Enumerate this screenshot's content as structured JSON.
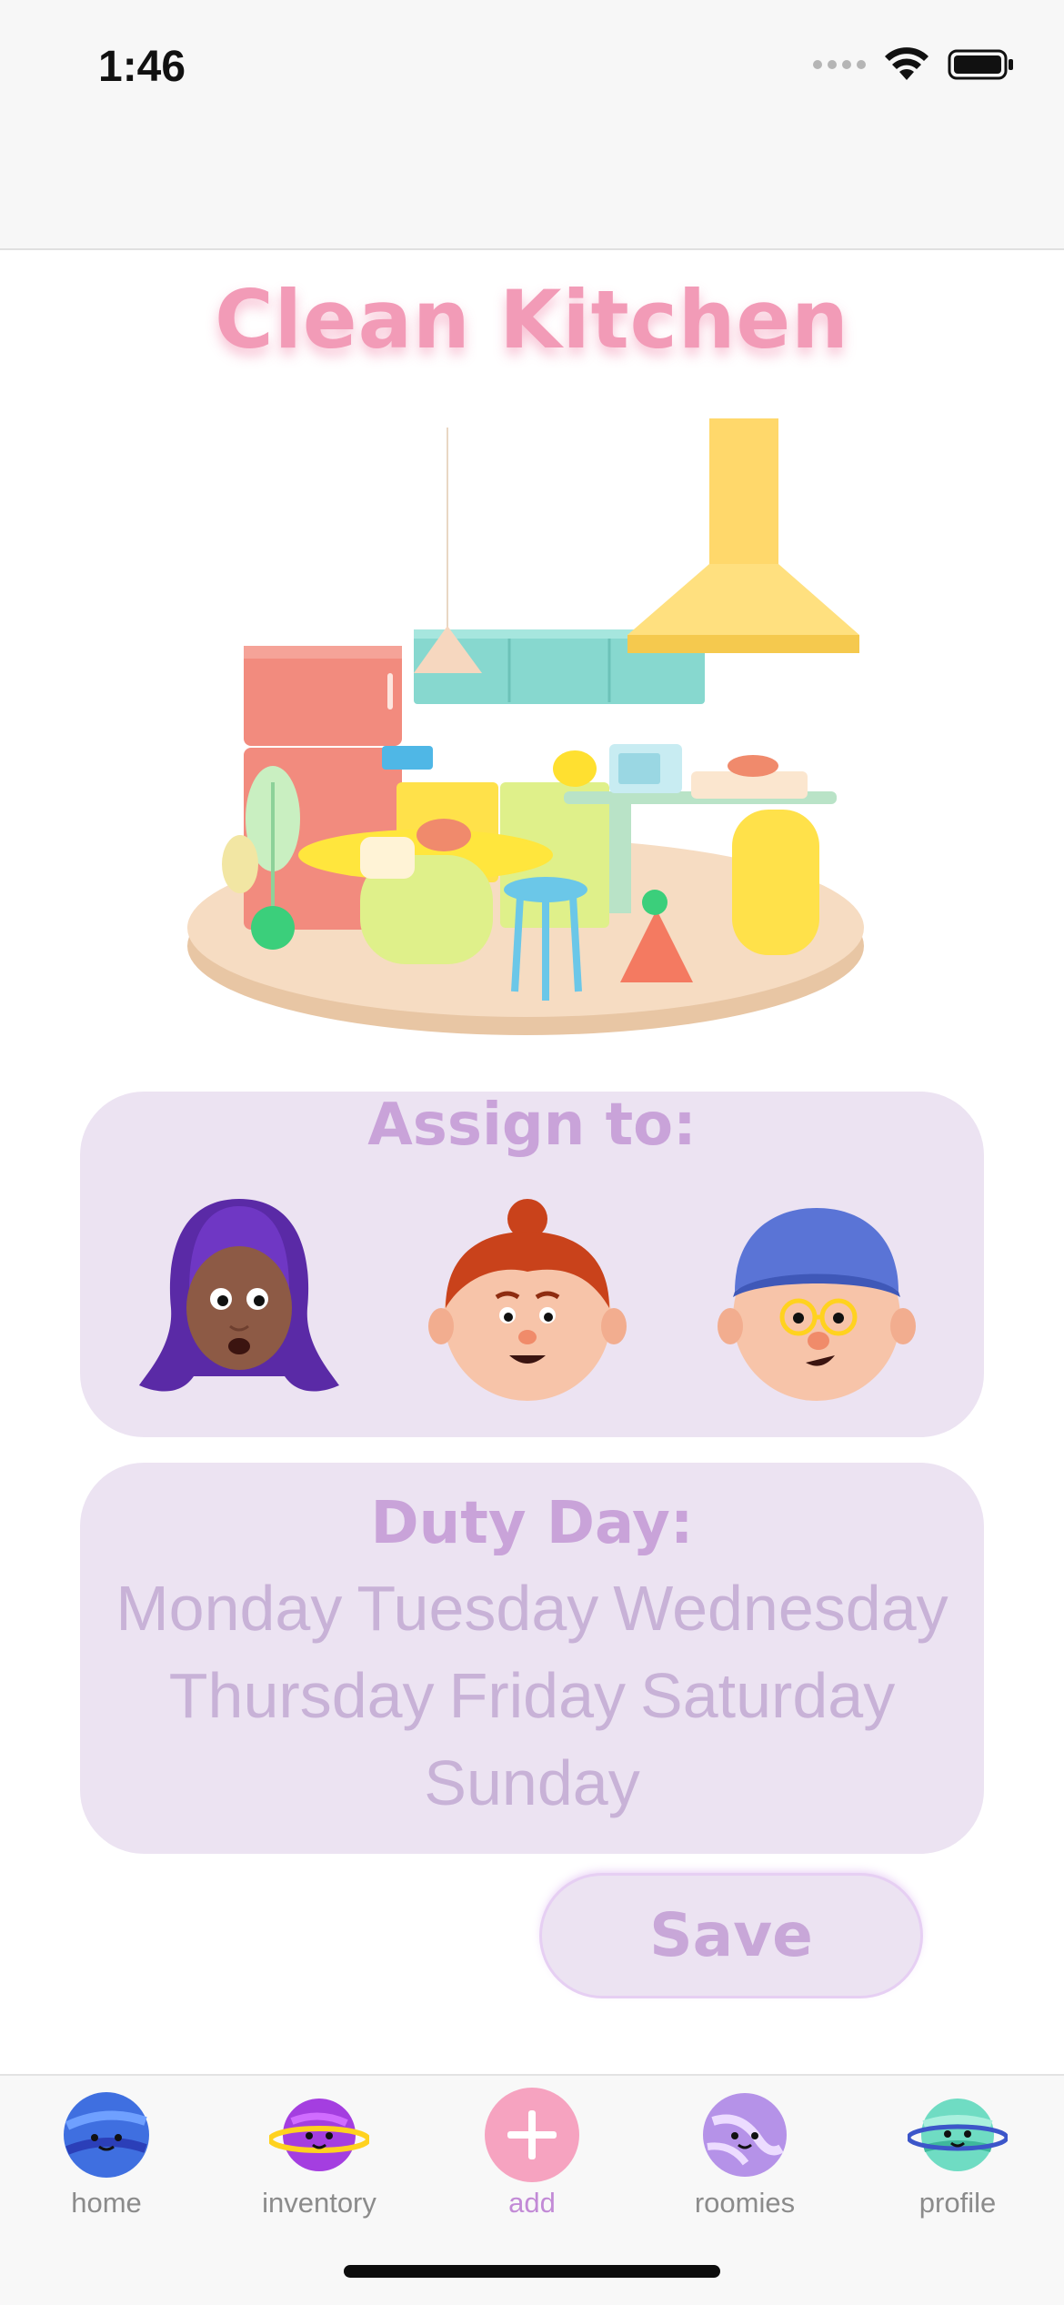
{
  "status_bar": {
    "time": "1:46"
  },
  "page": {
    "title": "Clean Kitchen"
  },
  "assign": {
    "heading": "Assign to:",
    "avatars": [
      {
        "name": "avatar-purple-hair"
      },
      {
        "name": "avatar-red-bun"
      },
      {
        "name": "avatar-blue-cap"
      }
    ]
  },
  "duty": {
    "heading": "Duty Day:",
    "days": [
      "Monday",
      "Tuesday",
      "Wednesday",
      "Thursday",
      "Friday",
      "Saturday",
      "Sunday"
    ]
  },
  "save_label": "Save",
  "tabs": [
    {
      "label": "home",
      "icon": "planet-blue-icon"
    },
    {
      "label": "inventory",
      "icon": "planet-ringed-purple-icon"
    },
    {
      "label": "add",
      "icon": "plus-icon",
      "active": true
    },
    {
      "label": "roomies",
      "icon": "planet-swirl-icon"
    },
    {
      "label": "profile",
      "icon": "planet-teal-ringed-icon"
    }
  ],
  "colors": {
    "accent_pink": "#f29bb7",
    "card_bg": "#ece3f2",
    "heading_purple": "#c9a3d9",
    "active_tab": "#c28ad6"
  }
}
